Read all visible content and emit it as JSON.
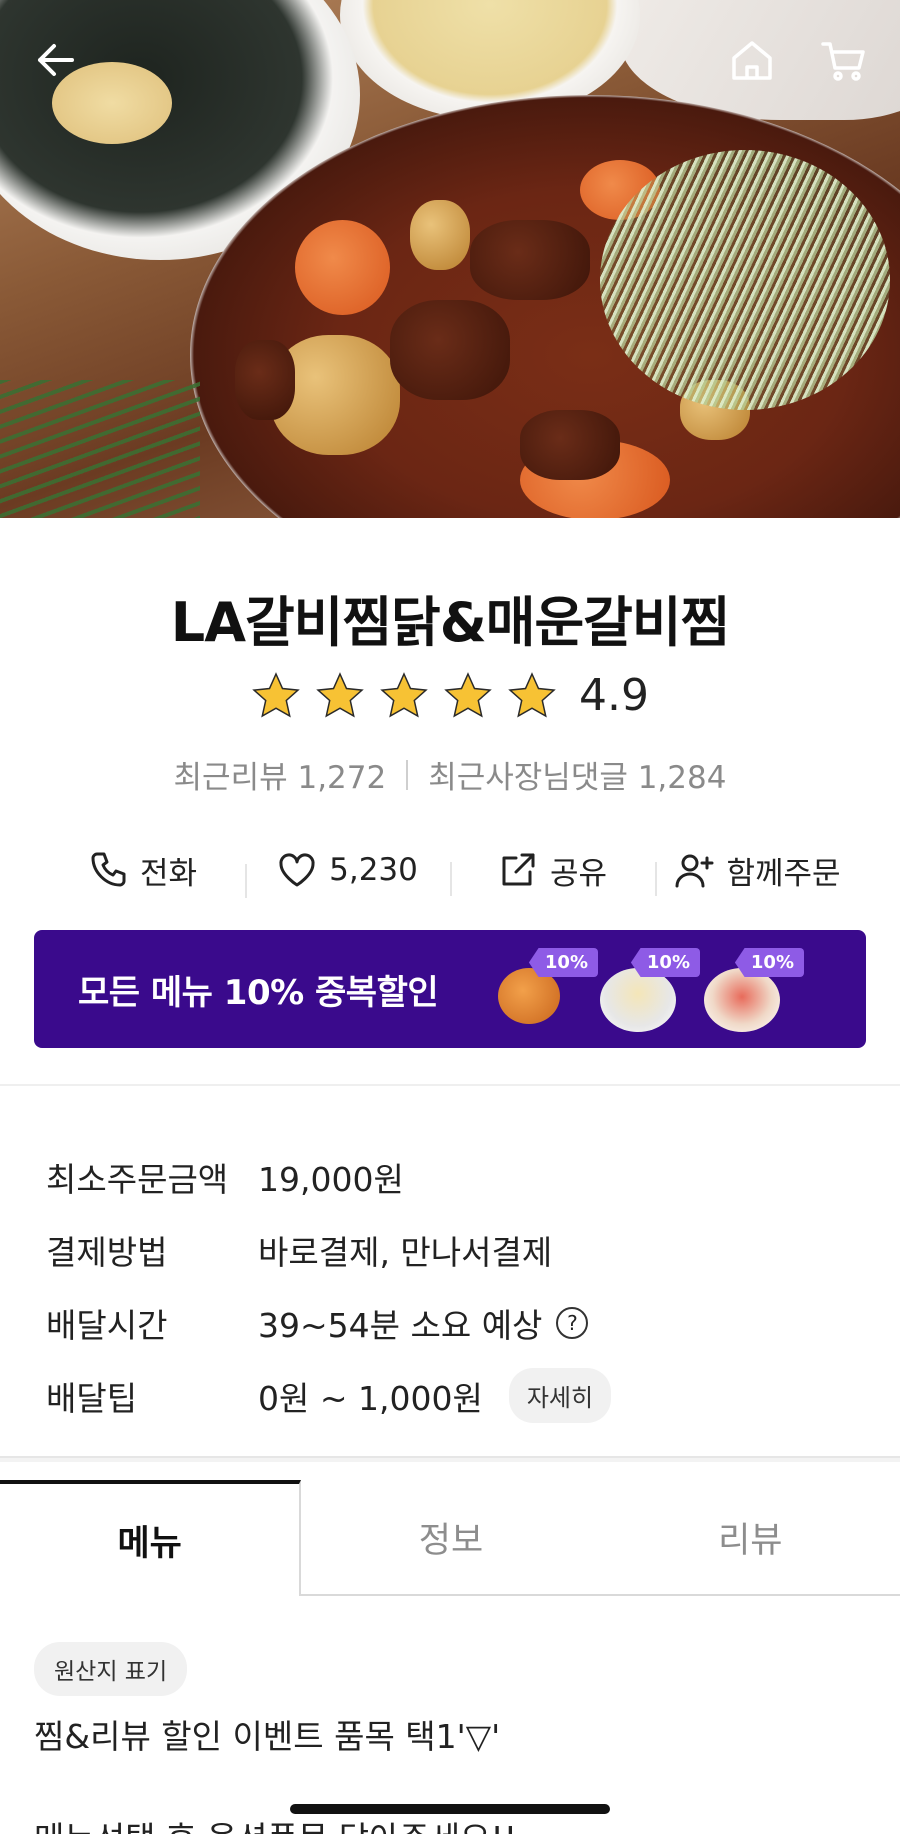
{
  "nav": {
    "back_icon": "arrow-left-icon",
    "home_icon": "home-icon",
    "cart_icon": "cart-icon"
  },
  "store": {
    "name": "LA갈비찜닭&매운갈비찜",
    "rating": {
      "stars": 5,
      "value": "4.9"
    },
    "recent_reviews": "최근리뷰 1,272",
    "recent_owner_replies": "최근사장님댓글 1,284"
  },
  "actions": [
    {
      "icon": "phone-icon",
      "label": "전화"
    },
    {
      "icon": "heart-icon",
      "label": "5,230"
    },
    {
      "icon": "share-icon",
      "label": "공유"
    },
    {
      "icon": "add-person-icon",
      "label": "함께주문"
    }
  ],
  "banner": {
    "text": "모든 메뉴 10% 중복할인",
    "coupon_tag": "10%",
    "background": "#3a0a8c"
  },
  "info": {
    "min_order": {
      "label": "최소주문금액",
      "value": "19,000원"
    },
    "payment": {
      "label": "결제방법",
      "value": "바로결제, 만나서결제"
    },
    "delivery_time": {
      "label": "배달시간",
      "value": "39~54분 소요 예상",
      "help": "?"
    },
    "delivery_tip": {
      "label": "배달팁",
      "value": "0원 ~ 1,000원",
      "detail_button": "자세히"
    }
  },
  "tabs": [
    {
      "label": "메뉴",
      "active": true
    },
    {
      "label": "정보",
      "active": false
    },
    {
      "label": "리뷰",
      "active": false
    }
  ],
  "menu_section": {
    "origin_chip": "원산지 표기",
    "notice_line1": "찜&리뷰 할인 이벤트 품목 택1'▽'",
    "notice_line2": "메뉴선택 후 옵션품목 담아주세요!!"
  }
}
